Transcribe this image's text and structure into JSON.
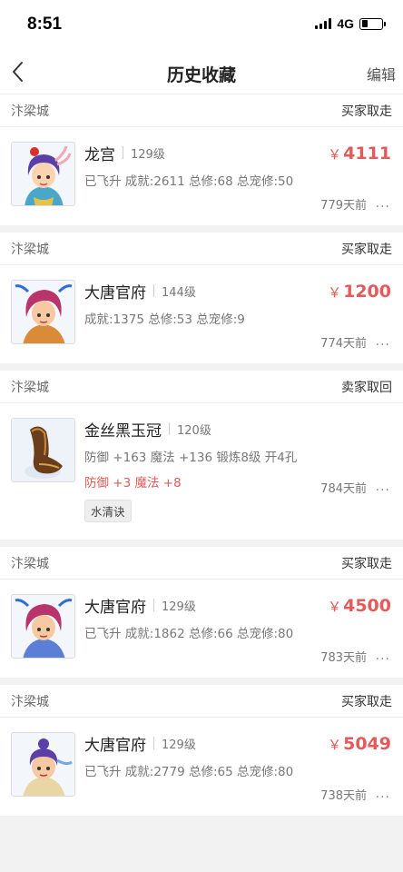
{
  "status_bar": {
    "time": "8:51",
    "network": "4G"
  },
  "nav": {
    "title": "历史收藏",
    "edit_label": "编辑"
  },
  "currency": "￥",
  "items": [
    {
      "server": "汴梁城",
      "trade": "买家取走",
      "name": "龙宫",
      "level": "129级",
      "desc": "已飞升 成就:2611 总修:68 总宠修:50",
      "price": "4111",
      "time": "779天前",
      "more": "···"
    },
    {
      "server": "汴梁城",
      "trade": "买家取走",
      "name": "大唐官府",
      "level": "144级",
      "desc": "成就:1375 总修:53 总宠修:9",
      "price": "1200",
      "time": "774天前",
      "more": "···"
    },
    {
      "server": "汴梁城",
      "trade": "卖家取回",
      "name": "金丝黑玉冠",
      "level": "120级",
      "desc": "防御 +163 魔法 +136 锻炼8级 开4孔",
      "desc2_a": "防御 +3 ",
      "desc2_b": "魔法 +8",
      "tag": "水清诀",
      "time": "784天前",
      "more": "···"
    },
    {
      "server": "汴梁城",
      "trade": "买家取走",
      "name": "大唐官府",
      "level": "129级",
      "desc": "已飞升 成就:1862 总修:66 总宠修:80",
      "price": "4500",
      "time": "783天前",
      "more": "···"
    },
    {
      "server": "汴梁城",
      "trade": "买家取走",
      "name": "大唐官府",
      "level": "129级",
      "desc": "已飞升 成就:2779 总修:65 总宠修:80",
      "price": "5049",
      "time": "738天前",
      "more": "···"
    }
  ]
}
